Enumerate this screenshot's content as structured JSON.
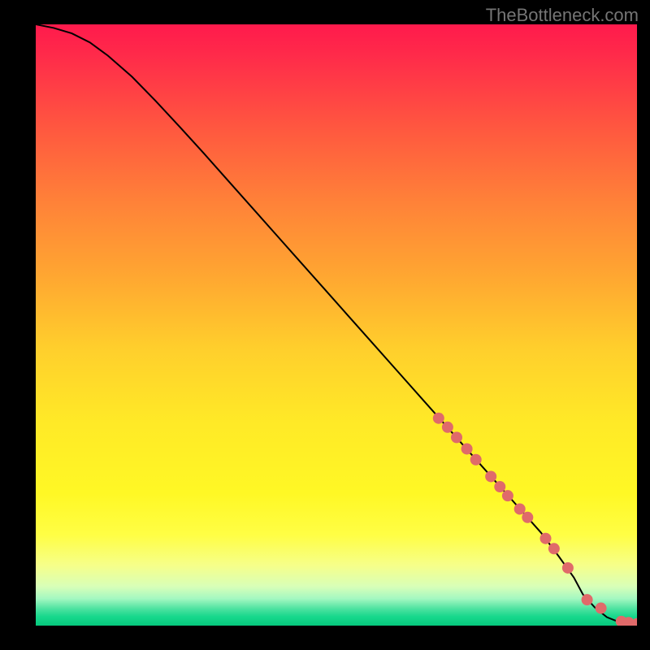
{
  "watermark": "TheBottleneck.com",
  "colors": {
    "frame": "#000000",
    "curve": "#000000",
    "markers": "#e06a6a",
    "gradient_stops": [
      {
        "offset": 0.0,
        "color": "#ff1a4c"
      },
      {
        "offset": 0.05,
        "color": "#ff2a4a"
      },
      {
        "offset": 0.18,
        "color": "#ff5a3f"
      },
      {
        "offset": 0.3,
        "color": "#ff8338"
      },
      {
        "offset": 0.42,
        "color": "#ffa731"
      },
      {
        "offset": 0.54,
        "color": "#ffcf2c"
      },
      {
        "offset": 0.66,
        "color": "#ffe927"
      },
      {
        "offset": 0.78,
        "color": "#fff825"
      },
      {
        "offset": 0.85,
        "color": "#fffe45"
      },
      {
        "offset": 0.9,
        "color": "#f6ff8a"
      },
      {
        "offset": 0.935,
        "color": "#d8ffb8"
      },
      {
        "offset": 0.955,
        "color": "#a4f8c1"
      },
      {
        "offset": 0.972,
        "color": "#4de2a0"
      },
      {
        "offset": 0.985,
        "color": "#17d88c"
      },
      {
        "offset": 1.0,
        "color": "#06c97d"
      }
    ]
  },
  "chart_data": {
    "type": "line",
    "title": "",
    "xlabel": "",
    "ylabel": "",
    "xlim": [
      0,
      100
    ],
    "ylim": [
      0,
      100
    ],
    "grid": false,
    "legend": false,
    "series": [
      {
        "name": "curve",
        "x": [
          0,
          3,
          6,
          9,
          12,
          16,
          20,
          24,
          28,
          32,
          36,
          40,
          44,
          48,
          52,
          56,
          60,
          64,
          68,
          72,
          76,
          80,
          84,
          87,
          89.5,
          91,
          93,
          95,
          97,
          99,
          100
        ],
        "y": [
          100,
          99.4,
          98.5,
          97.0,
          94.8,
          91.3,
          87.2,
          82.9,
          78.5,
          74.0,
          69.5,
          65.0,
          60.5,
          56.0,
          51.5,
          47.0,
          42.5,
          38.0,
          33.5,
          29.0,
          24.5,
          20.0,
          15.5,
          11.5,
          8.0,
          5.2,
          3.0,
          1.4,
          0.6,
          0.25,
          0.2
        ]
      }
    ],
    "markers": [
      {
        "x": 67.0,
        "y": 34.5
      },
      {
        "x": 68.5,
        "y": 33.0
      },
      {
        "x": 70.0,
        "y": 31.3
      },
      {
        "x": 71.7,
        "y": 29.4
      },
      {
        "x": 73.2,
        "y": 27.6
      },
      {
        "x": 75.7,
        "y": 24.8
      },
      {
        "x": 77.2,
        "y": 23.1
      },
      {
        "x": 78.5,
        "y": 21.6
      },
      {
        "x": 80.5,
        "y": 19.4
      },
      {
        "x": 81.8,
        "y": 18.0
      },
      {
        "x": 84.8,
        "y": 14.5
      },
      {
        "x": 86.2,
        "y": 12.8
      },
      {
        "x": 88.5,
        "y": 9.6
      },
      {
        "x": 91.7,
        "y": 4.3
      },
      {
        "x": 94.0,
        "y": 2.9
      },
      {
        "x": 97.4,
        "y": 0.7
      },
      {
        "x": 98.6,
        "y": 0.5
      },
      {
        "x": 100.0,
        "y": 0.3
      }
    ],
    "marker_radius_px": 7
  }
}
